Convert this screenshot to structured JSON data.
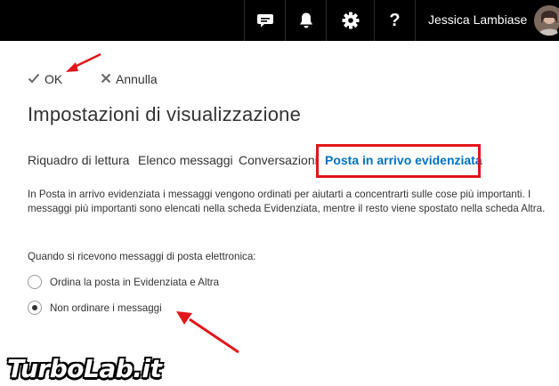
{
  "topbar": {
    "icons": [
      "chat-icon",
      "bell-icon",
      "gear-icon",
      "help-icon"
    ],
    "help_label": "?",
    "user_name": "Jessica Lambiase",
    "status_color": "#5cb85c"
  },
  "actions": {
    "ok_label": "OK",
    "cancel_label": "Annulla"
  },
  "page_title": "Impostazioni di visualizzazione",
  "tabs": [
    {
      "label": "Riquadro di lettura",
      "active": false
    },
    {
      "label": "Elenco messaggi",
      "active": false
    },
    {
      "label": "Conversazioni",
      "active": false
    },
    {
      "label": "Posta in arrivo evidenziata",
      "active": true
    }
  ],
  "description": "In Posta in arrivo evidenziata i messaggi vengono ordinati per aiutarti a concentrarti sulle cose più importanti. I messaggi più importanti sono elencati nella scheda Evidenziata, mentre il resto viene spostato nella scheda Altra.",
  "question": "Quando si ricevono messaggi di posta elettronica:",
  "options": [
    {
      "label": "Ordina la posta in Evidenziata e Altra",
      "checked": false
    },
    {
      "label": "Non ordinare i messaggi",
      "checked": true
    }
  ],
  "watermark": "TurboLab.it",
  "colors": {
    "accent": "#0072c6",
    "highlight": "#e1161b",
    "topbar": "#000000"
  }
}
